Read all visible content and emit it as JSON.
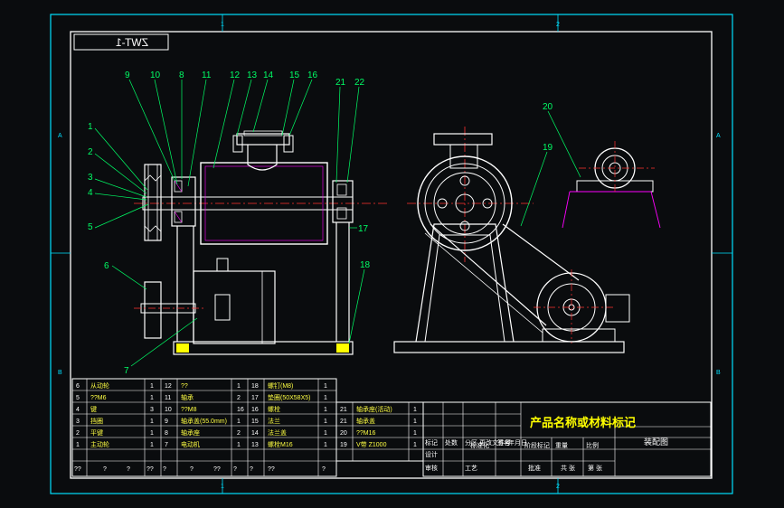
{
  "drawing": {
    "code_box": "ZWT-1",
    "title_text": "产品名称或材料标记",
    "subtitle_text": "装配图",
    "border_marks": {
      "top": [
        "1",
        "2"
      ],
      "bottom": [
        "1",
        "2"
      ],
      "left": [
        "A",
        "B"
      ],
      "right": [
        "A",
        "B"
      ]
    }
  },
  "callouts": [
    "1",
    "2",
    "3",
    "4",
    "5",
    "6",
    "7",
    "8",
    "9",
    "10",
    "11",
    "12",
    "13",
    "14",
    "15",
    "16",
    "17",
    "18",
    "19",
    "20",
    "21",
    "22"
  ],
  "bom": {
    "rows": [
      [
        {
          "n": "6",
          "t": "从动轮"
        },
        {
          "q": "1"
        },
        {
          "n": "12",
          "t": "??"
        },
        {
          "q": "1"
        },
        {
          "n": "18",
          "t": "螺钉(M8)"
        },
        {
          "q": "1"
        }
      ],
      [
        {
          "n": "5",
          "t": "??M6"
        },
        {
          "q": "1"
        },
        {
          "n": "11",
          "t": "轴承"
        },
        {
          "q": "2"
        },
        {
          "n": "17",
          "t": "垫圈(50X58X5)"
        },
        {
          "q": "1"
        }
      ],
      [
        {
          "n": "4",
          "t": "键"
        },
        {
          "q": "3"
        },
        {
          "n": "10",
          "t": "??M8"
        },
        {
          "q": "16"
        },
        {
          "n": "16",
          "t": "螺栓"
        },
        {
          "q": "1"
        }
      ],
      [
        {
          "n": "3",
          "t": "挡圈"
        },
        {
          "q": "1"
        },
        {
          "n": "9",
          "t": "轴承盖(55.0mm)"
        },
        {
          "q": "1"
        },
        {
          "n": "15",
          "t": "法兰"
        },
        {
          "q": "1"
        }
      ],
      [
        {
          "n": "2",
          "t": "平键"
        },
        {
          "q": "1"
        },
        {
          "n": "8",
          "t": "轴承座"
        },
        {
          "q": "2"
        },
        {
          "n": "14",
          "t": "法兰盖"
        },
        {
          "q": "1"
        }
      ],
      [
        {
          "n": "1",
          "t": "主动轮"
        },
        {
          "q": "1"
        },
        {
          "n": "7",
          "t": "电动机"
        },
        {
          "q": "1"
        },
        {
          "n": "13",
          "t": "螺栓M16"
        },
        {
          "q": "1"
        }
      ]
    ],
    "right_rows": [
      {
        "n": "21",
        "t": "轴承座(活动)",
        "q": "1"
      },
      {
        "n": "21",
        "t": "轴承盖",
        "q": "1"
      },
      {
        "n": "20",
        "t": "??M16",
        "q": "1"
      },
      {
        "n": "19",
        "t": "V带 Z1000",
        "q": "1"
      }
    ],
    "footer": [
      "??",
      "?",
      "?",
      "??",
      "?",
      "?",
      "??",
      "?",
      "?",
      "??",
      "?"
    ]
  },
  "titleblock": {
    "labels": [
      "标记",
      "处数",
      "分区",
      "更改文件号",
      "签名",
      "年月日",
      "设计",
      "标准化",
      "阶段标记",
      "重量",
      "比例",
      "审核",
      "工艺",
      "批准",
      "共 张",
      "第 张"
    ]
  }
}
